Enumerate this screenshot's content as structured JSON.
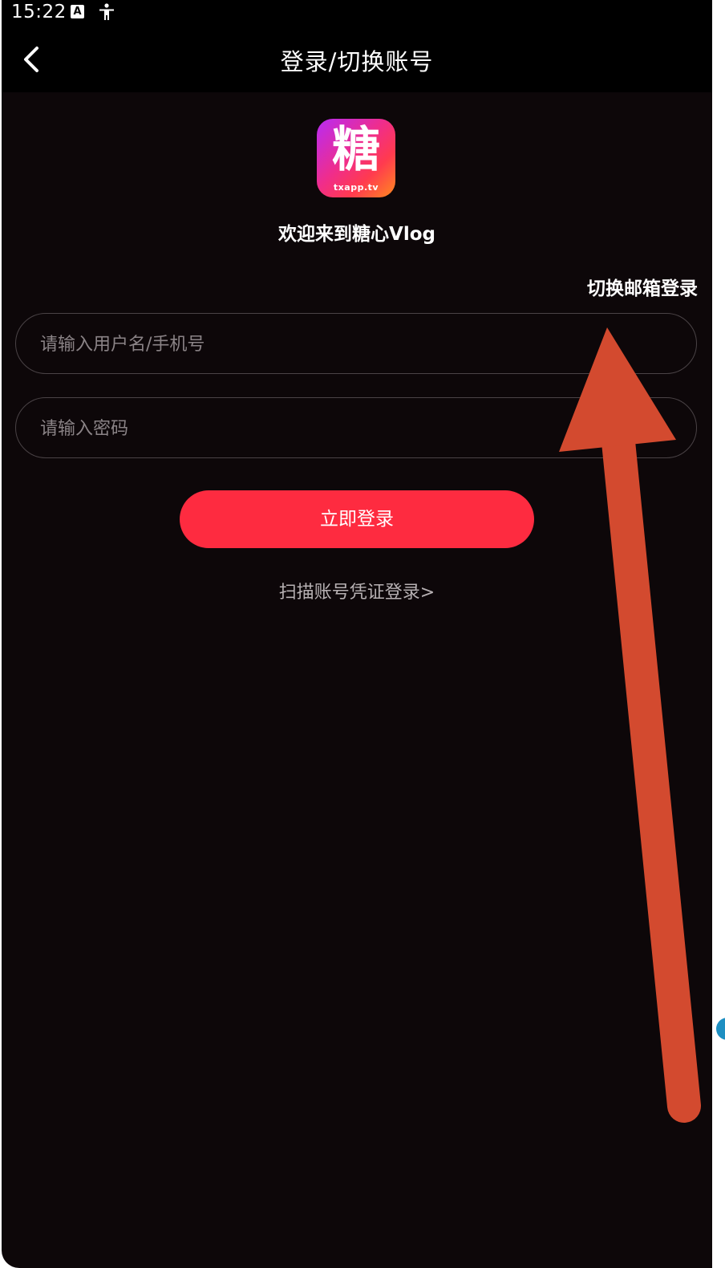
{
  "status_bar": {
    "time": "15:22",
    "icons": [
      "a-notification-icon",
      "accessibility-icon"
    ]
  },
  "header": {
    "title": "登录/切换账号",
    "back_icon": "chevron-left-icon"
  },
  "app": {
    "logo_glyph": "糖",
    "logo_caption": "txapp.tv",
    "welcome": "欢迎来到糖心Vlog"
  },
  "form": {
    "switch_email_label": "切换邮箱登录",
    "username_placeholder": "请输入用户名/手机号",
    "username_value": "",
    "password_placeholder": "请输入密码",
    "password_value": "",
    "login_button_label": "立即登录",
    "scan_link_label": "扫描账号凭证登录>"
  },
  "colors": {
    "background": "#0d0709",
    "bar": "#000000",
    "accent": "#fe2b40",
    "annotation_arrow": "#d34a2f"
  }
}
